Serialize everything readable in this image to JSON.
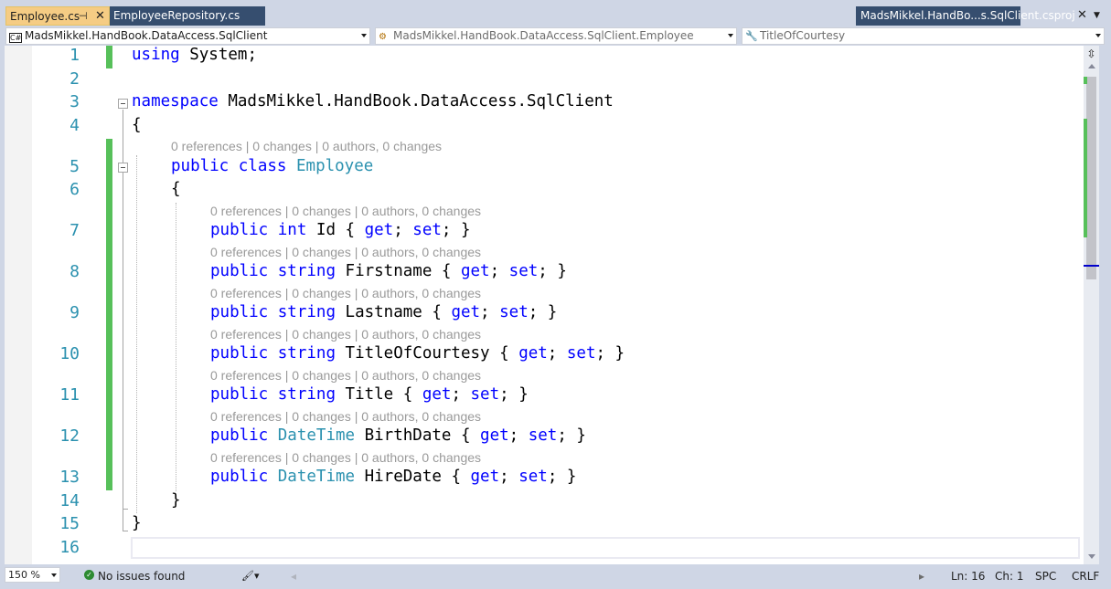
{
  "tabs": {
    "active_label": "Employee.cs",
    "inactive_label": "EmployeeRepository.cs",
    "project_label": "MadsMikkel.HandBo...s.SqlClient.csproj",
    "pin_icon": "pin-icon",
    "close_icon": "close-icon"
  },
  "nav": {
    "project": "MadsMikkel.HandBook.DataAccess.SqlClient",
    "type": "MadsMikkel.HandBook.DataAccess.SqlClient.Employee",
    "member": "TitleOfCourtesy"
  },
  "lens_text": "0 references | 0 changes | 0 authors, 0 changes",
  "code": {
    "line1_kw": "using",
    "line1_rest": " System;",
    "line3_kw": "namespace",
    "line3_rest": " MadsMikkel.HandBook.DataAccess.SqlClient",
    "open_brace": "{",
    "close_brace": "}",
    "public": "public",
    "class": "class",
    "class_name": "Employee",
    "int": "int",
    "string": "string",
    "datetime": "DateTime",
    "get": "get",
    "set": "set",
    "props": {
      "id": "Id",
      "firstname": "Firstname",
      "lastname": "Lastname",
      "titleofcourtesy": "TitleOfCourtesy",
      "title": "Title",
      "birthdate": "BirthDate",
      "hiredate": "HireDate"
    },
    "accessor_open": " { ",
    "accessor_mid": "; ",
    "accessor_end": "; }"
  },
  "line_numbers": [
    "1",
    "2",
    "3",
    "4",
    "5",
    "6",
    "7",
    "8",
    "9",
    "10",
    "11",
    "12",
    "13",
    "14",
    "15",
    "16"
  ],
  "status": {
    "zoom": "150 %",
    "issues": "No issues found",
    "ln": "Ln: 16",
    "ch": "Ch: 1",
    "spc": "SPC",
    "crlf": "CRLF"
  },
  "colors": {
    "keyword": "#0000ff",
    "type": "#2b91af",
    "line_number": "#2b91af",
    "change_bar": "#57c05a",
    "active_tab": "#f5cc84"
  }
}
